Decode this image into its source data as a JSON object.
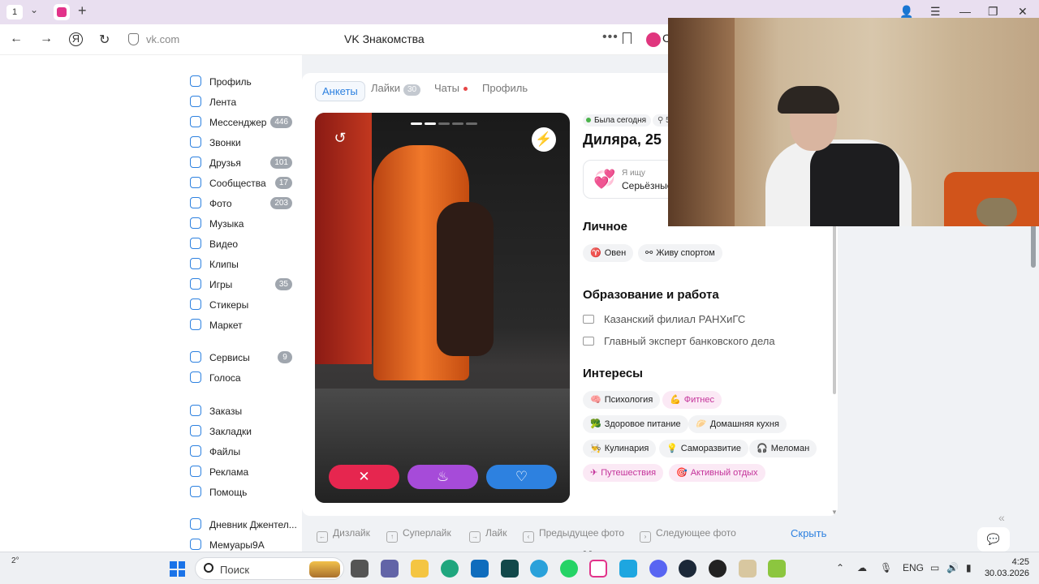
{
  "browser": {
    "tab_number": "1",
    "url": "vk.com",
    "page_title": "VK Знакомства",
    "alisa_letter": "С"
  },
  "sidebar": {
    "items": [
      {
        "label": "Профиль",
        "badge": ""
      },
      {
        "label": "Лента",
        "badge": ""
      },
      {
        "label": "Мессенджер",
        "badge": "446"
      },
      {
        "label": "Звонки",
        "badge": ""
      },
      {
        "label": "Друзья",
        "badge": "101"
      },
      {
        "label": "Сообщества",
        "badge": "17"
      },
      {
        "label": "Фото",
        "badge": "203"
      },
      {
        "label": "Музыка",
        "badge": ""
      },
      {
        "label": "Видео",
        "badge": ""
      },
      {
        "label": "Клипы",
        "badge": ""
      },
      {
        "label": "Игры",
        "badge": "35"
      },
      {
        "label": "Стикеры",
        "badge": ""
      },
      {
        "label": "Маркет",
        "badge": ""
      },
      {
        "label": "Сервисы",
        "badge": "9"
      },
      {
        "label": "Голоса",
        "badge": ""
      },
      {
        "label": "Заказы",
        "badge": ""
      },
      {
        "label": "Закладки",
        "badge": ""
      },
      {
        "label": "Файлы",
        "badge": ""
      },
      {
        "label": "Реклама",
        "badge": ""
      },
      {
        "label": "Помощь",
        "badge": ""
      },
      {
        "label": "Дневник Джентел...",
        "badge": ""
      },
      {
        "label": "Мемуары9А",
        "badge": ""
      }
    ]
  },
  "tabs": {
    "ankety": "Анкеты",
    "likes": "Лайки",
    "likes_count": "30",
    "chats": "Чаты",
    "profile": "Профиль"
  },
  "profile": {
    "online": "Была сегодня",
    "location": "5",
    "name": "Диляра, 25",
    "seek_label": "Я ищу",
    "seek_value": "Серьёзные",
    "personal_title": "Личное",
    "personal_chips": [
      "Овен",
      "Живу спортом"
    ],
    "edu_title": "Образование и работа",
    "education": "Казанский филиал РАНХиГС",
    "job": "Главный эксперт банковского дела",
    "interests_title": "Интересы",
    "interests": [
      {
        "label": "Психология",
        "icon": "🧠"
      },
      {
        "label": "Фитнес",
        "icon": "💪"
      },
      {
        "label": "Здоровое питание",
        "icon": "🥦"
      },
      {
        "label": "Домашняя кухня",
        "icon": "🥟"
      },
      {
        "label": "Кулинария",
        "icon": "👨‍🍳"
      },
      {
        "label": "Саморазвитие",
        "icon": "💡"
      },
      {
        "label": "Меломан",
        "icon": "🎧"
      },
      {
        "label": "Путешествия",
        "icon": "✈"
      },
      {
        "label": "Активный отдых",
        "icon": "🎯"
      }
    ],
    "music_title": "Музыка"
  },
  "photo": {
    "current_index": 2,
    "total": 5
  },
  "hotkeys": {
    "dislike": "Дизлайк",
    "superlike": "Суперлайк",
    "like": "Лайк",
    "prev_photo": "Предыдущее фото",
    "next_photo": "Следующее фото",
    "hide": "Скрыть"
  },
  "taskbar": {
    "weather": "2°",
    "search": "Поиск",
    "lang": "ENG",
    "time": "4:25",
    "date": "30.03.2026"
  },
  "colors": {
    "accent": "#2d81e0",
    "dislike": "#e6264f",
    "superlike": "#a64bd9",
    "like": "#2d81e0",
    "pink_chip_text": "#c4339a"
  }
}
